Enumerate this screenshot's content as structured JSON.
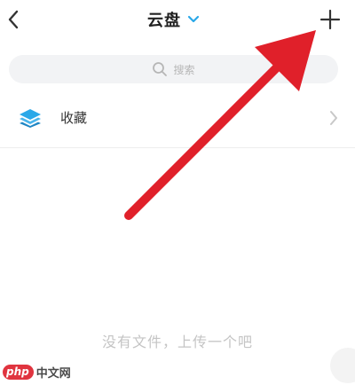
{
  "header": {
    "title": "云盘",
    "back_icon": "chevron-left-icon",
    "title_caret_icon": "chevron-down-icon",
    "add_icon": "plus-icon"
  },
  "search": {
    "placeholder": "搜索",
    "icon": "search-icon"
  },
  "favorites": {
    "label": "收藏",
    "icon": "layers-icon",
    "chevron_icon": "chevron-right-icon"
  },
  "empty_state": {
    "message": "没有文件，上传一个吧"
  },
  "watermark": {
    "brand": "php",
    "site": "中文网"
  },
  "colors": {
    "accent_blue": "#2aa8e8",
    "annotation_arrow": "#e0202a",
    "search_bg": "#f2f3f5"
  },
  "annotation": {
    "type": "arrow",
    "points_to": "add-button"
  }
}
